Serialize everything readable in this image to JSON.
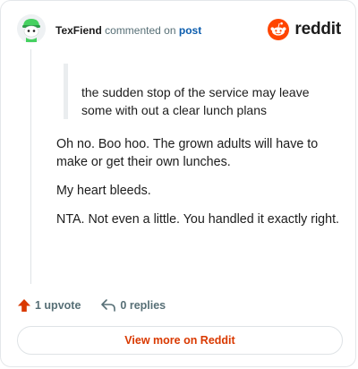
{
  "header": {
    "author": "TexFiend",
    "commented_text": "commented on",
    "post_link": "post",
    "brand_name": "reddit"
  },
  "quote": {
    "text": "the sudden stop of the service may leave some with out a clear lunch plans"
  },
  "comment": {
    "paragraphs": [
      "Oh no. Boo hoo. The grown adults will have to make or get their own lunches.",
      "My heart bleeds.",
      "NTA. Not even a little. You handled it exactly right."
    ]
  },
  "footer": {
    "upvote_label": "1 upvote",
    "replies_label": "0 replies"
  },
  "view_more_label": "View more on Reddit",
  "colors": {
    "upvote_accent": "#d93900",
    "reddit_orange": "#ff4500",
    "link_blue": "#0b5cad",
    "avatar_green": "#46d160"
  },
  "icons": {
    "avatar": "snoo-avatar-icon",
    "brand": "reddit-logo-icon",
    "upvote": "upvote-arrow-icon",
    "reply": "reply-arrow-icon"
  }
}
